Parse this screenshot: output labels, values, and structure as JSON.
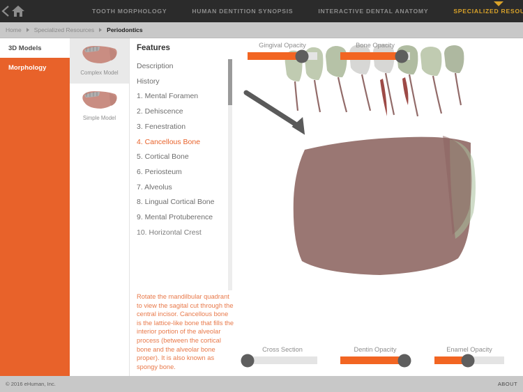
{
  "topnav": {
    "back_icon": "chevron-left-icon",
    "home_icon": "home-icon",
    "tabs": [
      {
        "label": "TOOTH MORPHOLOGY",
        "active": false
      },
      {
        "label": "HUMAN DENTITION SYNOPSIS",
        "active": false
      },
      {
        "label": "INTERACTIVE DENTAL ANATOMY",
        "active": false
      },
      {
        "label": "SPECIALIZED RESOURCES",
        "active": true
      }
    ],
    "background": "#2b2b2b",
    "active_color": "#d9a229"
  },
  "breadcrumb": {
    "items": [
      "Home",
      "Specialized Resources",
      "Periodontics"
    ],
    "current": "Periodontics"
  },
  "sidebar": {
    "items": [
      {
        "label": "3D Models",
        "active": false
      },
      {
        "label": "Morphology",
        "active": true
      }
    ],
    "accent": "#e8622a"
  },
  "models": {
    "thumbs": [
      {
        "label": "Complex Model",
        "selected": true
      },
      {
        "label": "Simple Model",
        "selected": false
      }
    ]
  },
  "features": {
    "title": "Features",
    "items": [
      "Description",
      "History",
      "1. Mental Foramen",
      "2. Dehiscence",
      "3. Fenestration",
      "4. Cancellous Bone",
      "5. Cortical Bone",
      "6. Periosteum",
      "7. Alveolus",
      "8. Lingual Cortical Bone",
      "9. Mental Protuberence",
      "10. Horizontal Crest"
    ],
    "active_index": 5,
    "note": "Rotate the mandilbular quadrant to view the sagital cut through the central incisor. Cancellous bone is the lattice-like bone that fills the interior portion of the alveolar process (between the cortical bone and the alveolar bone proper). It is also known as spongy bone."
  },
  "sliders": {
    "top": [
      {
        "label": "Gingival Opacity",
        "value": 78
      },
      {
        "label": "Bone Opacity",
        "value": 88
      }
    ],
    "bottom": [
      {
        "label": "Cross Section",
        "value": 0
      },
      {
        "label": "Dentin Opacity",
        "value": 92
      },
      {
        "label": "Enamel Opacity",
        "value": 48
      }
    ],
    "fill_color": "#f26522",
    "thumb_color": "#5e5e5e",
    "track_color": "#e4e4e4"
  },
  "viewport": {
    "model_name": "mandible-3d-model",
    "pointer_icon": "arrow-pointer-icon"
  },
  "footer": {
    "copyright": "© 2016 eHuman, Inc.",
    "about": "ABOUT"
  }
}
